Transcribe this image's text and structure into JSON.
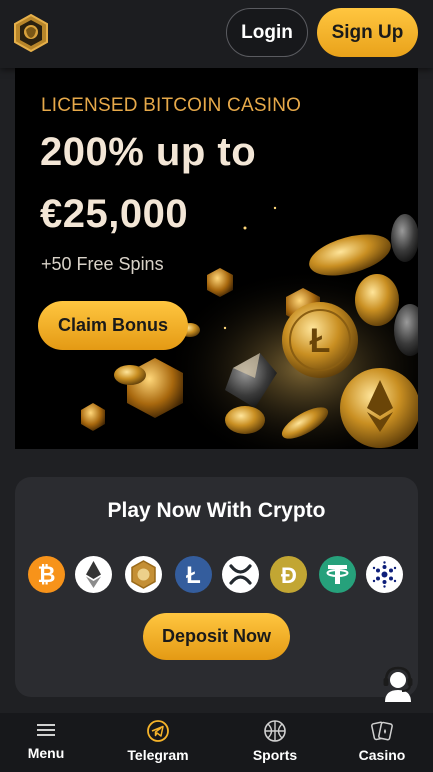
{
  "header": {
    "logo_icon": "lion-shield-logo",
    "login_label": "Login",
    "signup_label": "Sign Up"
  },
  "hero": {
    "subtitle": "LICENSED BITCOIN CASINO",
    "headline_line1": "200% up to",
    "headline_line2": "€25,000",
    "spins": "+50 Free Spins",
    "claim_label": "Claim Bonus"
  },
  "crypto_panel": {
    "title": "Play Now With Crypto",
    "coins": [
      {
        "name": "bitcoin",
        "color": "#f7931a"
      },
      {
        "name": "ethereum",
        "color": "#ffffff"
      },
      {
        "name": "casino-token",
        "color": "#ffffff"
      },
      {
        "name": "litecoin",
        "color": "#345d9d"
      },
      {
        "name": "ripple",
        "color": "#ffffff"
      },
      {
        "name": "dogecoin",
        "color": "#c2a633"
      },
      {
        "name": "tether",
        "color": "#26a17b"
      },
      {
        "name": "cardano",
        "color": "#ffffff"
      }
    ],
    "deposit_label": "Deposit Now"
  },
  "support_icon": "headset-support-icon",
  "bottom_nav": {
    "items": [
      {
        "label": "Menu",
        "icon": "hamburger-icon"
      },
      {
        "label": "Telegram",
        "icon": "telegram-icon"
      },
      {
        "label": "Sports",
        "icon": "basketball-icon"
      },
      {
        "label": "Casino",
        "icon": "cards-icon"
      }
    ]
  },
  "colors": {
    "accent": "#f5b32a",
    "accent_text": "#e6a94a",
    "background": "#1f2023",
    "panel": "#2b2c30"
  }
}
